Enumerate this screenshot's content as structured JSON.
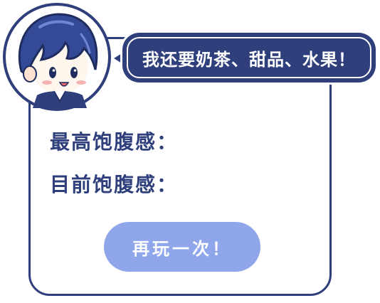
{
  "speech_bubble": {
    "text": "我还要奶茶、甜品、水果！"
  },
  "stats": {
    "max_label": "最高饱腹感：",
    "current_label": "目前饱腹感："
  },
  "actions": {
    "replay_label": "再玩一次！"
  },
  "avatar": {
    "icon": "chibi-character-icon"
  },
  "colors": {
    "primary": "#2e3f7c",
    "button": "#8fa6ea",
    "background": "#ffffff"
  }
}
